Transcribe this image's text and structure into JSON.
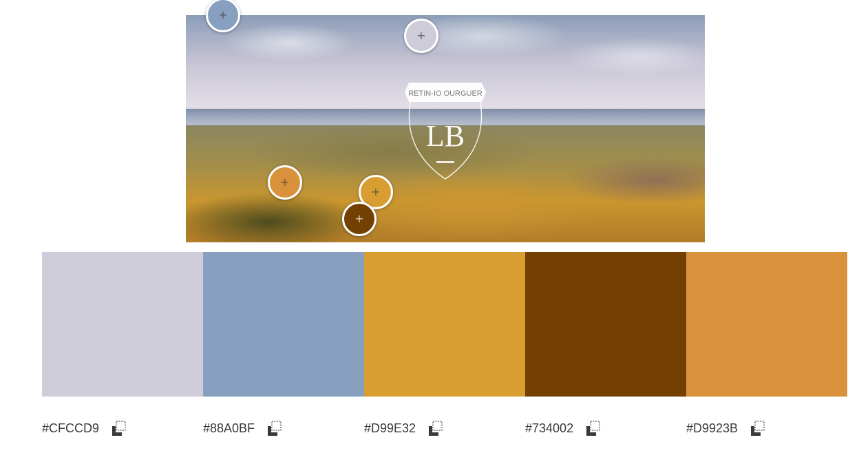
{
  "image": {
    "emblem_text_top": "RETIN-IO OURGUER",
    "emblem_monogram": "LB"
  },
  "pickers": [
    {
      "name": "picker-1",
      "color": "#88A0BF"
    },
    {
      "name": "picker-2",
      "color": "#CFCCD9"
    },
    {
      "name": "picker-3",
      "color": "#D9923B"
    },
    {
      "name": "picker-4",
      "color": "#D99E32"
    },
    {
      "name": "picker-5",
      "color": "#734002"
    }
  ],
  "swatches": [
    {
      "hex": "#CFCCD9",
      "copy_icon": "copy-icon"
    },
    {
      "hex": "#88A0BF",
      "copy_icon": "copy-icon"
    },
    {
      "hex": "#D99E32",
      "copy_icon": "copy-icon"
    },
    {
      "hex": "#734002",
      "copy_icon": "copy-icon"
    },
    {
      "hex": "#D9923B",
      "copy_icon": "copy-icon"
    }
  ]
}
